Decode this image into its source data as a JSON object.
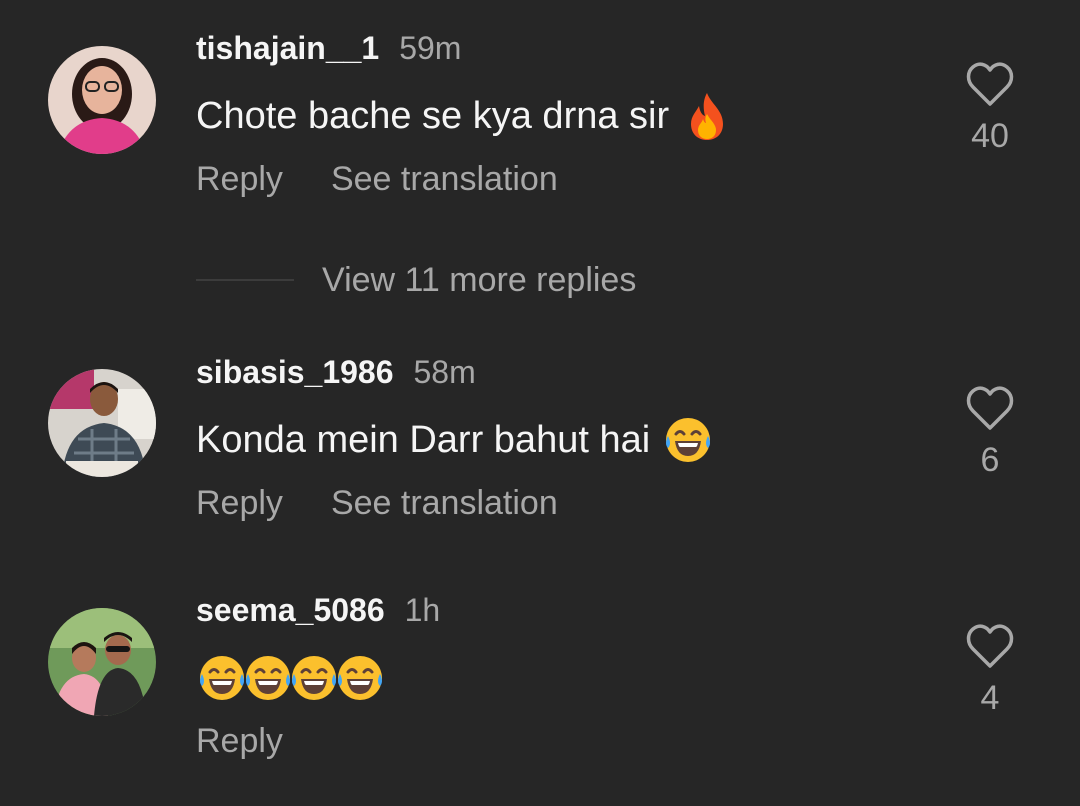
{
  "comments": [
    {
      "username": "tishajain__1",
      "time": "59m",
      "text": "Chote bache se kya drna sir",
      "emoji": "fire",
      "reply_label": "Reply",
      "translate_label": "See translation",
      "likes": "40",
      "avatar": "woman-with-glasses-avatar"
    },
    {
      "username": "sibasis_1986",
      "time": "58m",
      "text": "Konda mein Darr bahut hai",
      "emoji": "laughing",
      "reply_label": "Reply",
      "translate_label": "See translation",
      "likes": "6",
      "avatar": "man-in-checked-shirt-avatar"
    },
    {
      "username": "seema_5086",
      "time": "1h",
      "text": "",
      "emoji": "laughing x4",
      "reply_label": "Reply",
      "likes": "4",
      "avatar": "couple-outdoors-avatar"
    }
  ],
  "view_more_replies": "View 11 more replies",
  "colors": {
    "background": "#262626",
    "primary_text": "#f5f5f5",
    "secondary_text": "#a8a8a8"
  }
}
